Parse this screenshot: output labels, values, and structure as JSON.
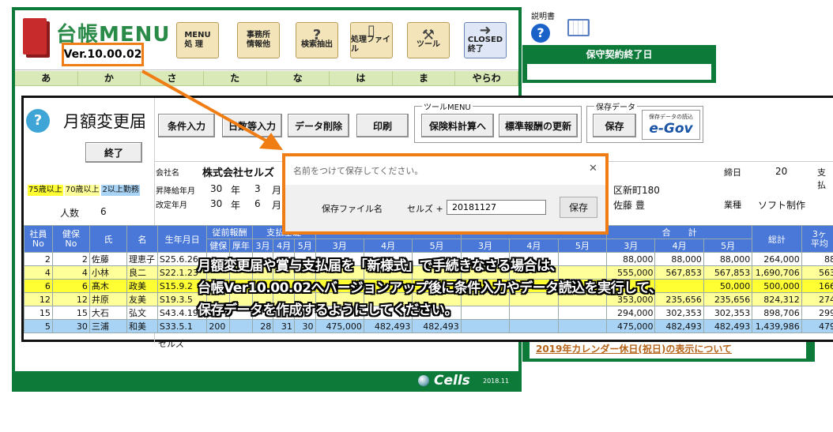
{
  "app": {
    "title": "台帳MENU",
    "version": "Ver.10.00.02",
    "toolbar": [
      {
        "label": "MENU\n処 理",
        "icon": "menu-icon"
      },
      {
        "label": "事務所\n情報他",
        "icon": "office-icon"
      },
      {
        "label": "検索抽出",
        "icon": "magnifier-question-icon"
      },
      {
        "label": "処理ファイル",
        "icon": "file-icon"
      },
      {
        "label": "ツール",
        "icon": "tool-icon"
      },
      {
        "label": "CLOSED\n終了",
        "icon": "exit-door-icon"
      }
    ],
    "kana_tabs": [
      "あ",
      "か",
      "さ",
      "た",
      "な",
      "は",
      "ま",
      "やらわ"
    ],
    "footer": {
      "brand": "Cells",
      "year": "2018.11"
    }
  },
  "right_panel": {
    "help_label": "説明書",
    "contract_title": "保守契約終了日",
    "calendar_link": "2019年カレンダー休日(祝日)の表示について"
  },
  "form": {
    "title": "月額変更届",
    "end_button": "終了",
    "buttons": [
      "条件入力",
      "日数等入力",
      "データ削除",
      "印刷"
    ],
    "tool_menu_label": "ツールMENU",
    "tool_buttons": [
      "保険料計算へ",
      "標準報酬の更新"
    ],
    "save_data_label": "保存データ",
    "save_button": "保存",
    "egov_caption": "保存データの読込",
    "egov_label": "e-Gov",
    "company_label": "会社名",
    "company_name": "株式会社セルズ",
    "promo_label": "昇降給年月",
    "promo_year": "30",
    "promo_month": "3",
    "rev_label": "改定年月",
    "rev_year": "30",
    "rev_month": "6",
    "nen": "年",
    "tsuki": "月",
    "address": "区新町180",
    "rep": "佐藤 豊",
    "closing_label": "締日",
    "closing_value": "20",
    "pay_label": "支払",
    "industry_label": "業種",
    "industry_value": "ソフト制作",
    "legend": [
      {
        "label": "75歳以上",
        "color": "#ffff33"
      },
      {
        "label": "70歳以上",
        "color": "#ffff99"
      },
      {
        "label": "2以上勤務",
        "color": "#a9d3f5"
      }
    ],
    "count_label": "人数",
    "count_value": "6",
    "table_headers": {
      "emp_no": "社員\nNo",
      "ins_no": "健保\nNo",
      "name_a": "氏",
      "name_b": "名",
      "birth": "生年月日",
      "prev": "従前報酬",
      "prev_a": "健保",
      "prev_b": "厚年",
      "days": "支払基礎",
      "m3": "3月",
      "m4": "4月",
      "m5": "5月",
      "total": "合　　計",
      "grand": "総計",
      "avg": "3ヶ\n平均"
    },
    "rows": [
      {
        "emp": "2",
        "ins": "2",
        "sei": "佐藤",
        "mei": "理恵子",
        "birth": "S25.6.26",
        "t3": "88,000",
        "t4": "88,000",
        "t5": "88,000",
        "sum": "264,000",
        "avg": "88",
        "bg": "#ffffff"
      },
      {
        "emp": "4",
        "ins": "4",
        "sei": "小林",
        "mei": "良二",
        "birth": "S22.1.23",
        "t3": "555,000",
        "t4": "567,853",
        "t5": "567,853",
        "sum": "1,690,706",
        "avg": "563",
        "bg": "#ffff99"
      },
      {
        "emp": "6",
        "ins": "6",
        "sei": "髙木",
        "mei": "政美",
        "birth": "S15.9.2",
        "t3": "",
        "t4": "",
        "t5": "50,000",
        "sum": "500,000",
        "avg": "166",
        "bg": "#ffff33"
      },
      {
        "emp": "12",
        "ins": "12",
        "sei": "井原",
        "mei": "友美",
        "birth": "S19.3.5",
        "t3": "353,000",
        "t4": "235,656",
        "t5": "235,656",
        "sum": "824,312",
        "avg": "274",
        "bg": "#ffff99"
      },
      {
        "emp": "15",
        "ins": "15",
        "sei": "大石",
        "mei": "弘文",
        "birth": "S43.4.19",
        "t3": "294,000",
        "t4": "302,353",
        "t5": "302,353",
        "sum": "898,706",
        "avg": "299",
        "bg": "#ffffff"
      },
      {
        "emp": "5",
        "ins": "30",
        "sei": "三浦",
        "mei": "和美",
        "birth": "S33.5.1",
        "prev": "200",
        "d3": "28",
        "d4": "31",
        "d5": "30",
        "p3": "475,000",
        "p4": "482,493",
        "p5": "482,493",
        "t3": "475,000",
        "t4": "482,493",
        "t5": "482,493",
        "sum": "1,439,986",
        "avg": "479",
        "bg": "#a9d3f5"
      }
    ],
    "trailing_text": "セルズ"
  },
  "dialog": {
    "title": "名前をつけて保存してください。",
    "close": "✕",
    "file_label": "保存ファイル名",
    "prefix": "セルズ +",
    "input_value": "20181127",
    "save_button": "保存"
  },
  "overlay": {
    "line1": "月額変更届や賞与支払届を「新様式」で手続きなさる場合は、",
    "line2": "台帳Ver10.00.02へバージョンアップ後に条件入力やデータ読込を実行して、",
    "line3": "保存データを作成するようにしてください。"
  },
  "colors": {
    "accent_orange": "#f07d14",
    "app_green": "#0d7a3a",
    "header_blue": "#4a78d8"
  }
}
